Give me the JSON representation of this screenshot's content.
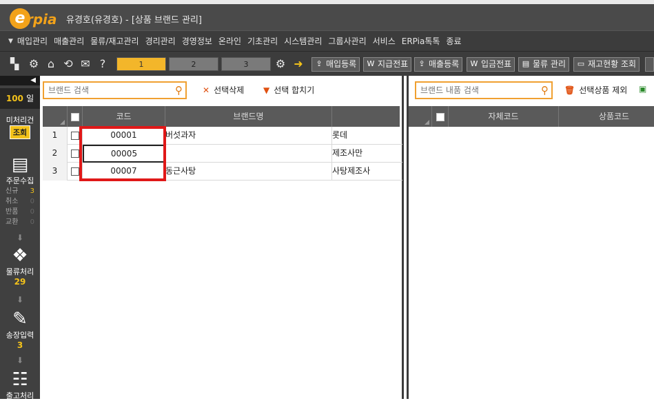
{
  "window": {
    "title": "유경호(유경호) - [상품 브랜드 관리]",
    "logo_text": "Erpia"
  },
  "menu": {
    "items": [
      "매입관리",
      "매출관리",
      "물류/재고관리",
      "경리관리",
      "경영정보",
      "온라인",
      "기초관리",
      "시스템관리",
      "그룹사관리",
      "서비스",
      "ERPia톡톡",
      "종료"
    ]
  },
  "toolbar": {
    "tabs": [
      "1",
      "2",
      "3"
    ],
    "buttons": [
      {
        "label": "매입등록",
        "icon": "upload-icon"
      },
      {
        "label": "지급전표",
        "icon": "w-doc-icon"
      },
      {
        "label": "매출등록",
        "icon": "upload-icon"
      },
      {
        "label": "입금전표",
        "icon": "w-doc-icon"
      },
      {
        "label": "물류 관리",
        "icon": "forklift-icon"
      },
      {
        "label": "재고현황 조회",
        "icon": "inventory-icon"
      }
    ]
  },
  "sidebar": {
    "days_value": "100",
    "days_unit": "일",
    "pending_label": "미처리건",
    "lookup_label": "조회",
    "order_label": "주문수집",
    "order_stats": [
      {
        "label": "신규",
        "value": "3"
      },
      {
        "label": "취소",
        "value": "0"
      },
      {
        "label": "반품",
        "value": "0"
      },
      {
        "label": "교환",
        "value": "0"
      }
    ],
    "logistics_label": "물류처리",
    "logistics_count": "29",
    "invoice_label": "송장입력",
    "invoice_count": "3",
    "shipping_label": "출고처리"
  },
  "left": {
    "search_placeholder": "브랜드 검색",
    "delete_label": "선택삭제",
    "merge_label": "선택 합치기",
    "columns": {
      "code": "코드",
      "brand": "브랜드명"
    },
    "rows": [
      {
        "num": "1",
        "code": "00001",
        "brand": "버섯과자",
        "maker": "롯데"
      },
      {
        "num": "2",
        "code": "00005",
        "brand": "",
        "maker": "제조사만"
      },
      {
        "num": "3",
        "code": "00007",
        "brand": "동근사탕",
        "maker": "사탕제조사"
      }
    ]
  },
  "right": {
    "search_placeholder": "브랜드 내품 검색",
    "exclude_label": "선택상품 제외",
    "columns": {
      "own_code": "자체코드",
      "product_code": "상품코드"
    }
  }
}
